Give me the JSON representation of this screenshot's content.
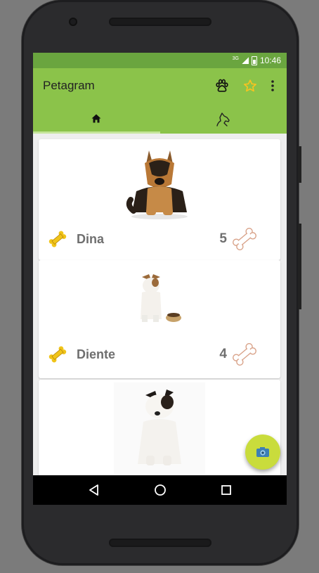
{
  "status_bar": {
    "network": "3G",
    "time": "10:46"
  },
  "app_bar": {
    "title": "Petagram"
  },
  "tabs": [
    {
      "icon": "home-icon",
      "selected": true
    },
    {
      "icon": "dog-head-icon",
      "selected": false
    }
  ],
  "pets": [
    {
      "name": "Dina",
      "rating": "5",
      "photo": "german-shepherd-puppy"
    },
    {
      "name": "Diente",
      "rating": "4",
      "photo": "jack-russell-with-bowl"
    },
    {
      "name": "",
      "rating": "",
      "photo": "jack-russell-sitting"
    }
  ],
  "fab": {
    "icon": "camera-icon"
  },
  "nav": {
    "back": "back-icon",
    "home": "home-circle-icon",
    "recents": "recents-icon"
  },
  "colors": {
    "status_bar": "#6aa53f",
    "toolbar": "#8bc34a",
    "fab": "#c9dc3c",
    "star": "#f9c31f"
  }
}
